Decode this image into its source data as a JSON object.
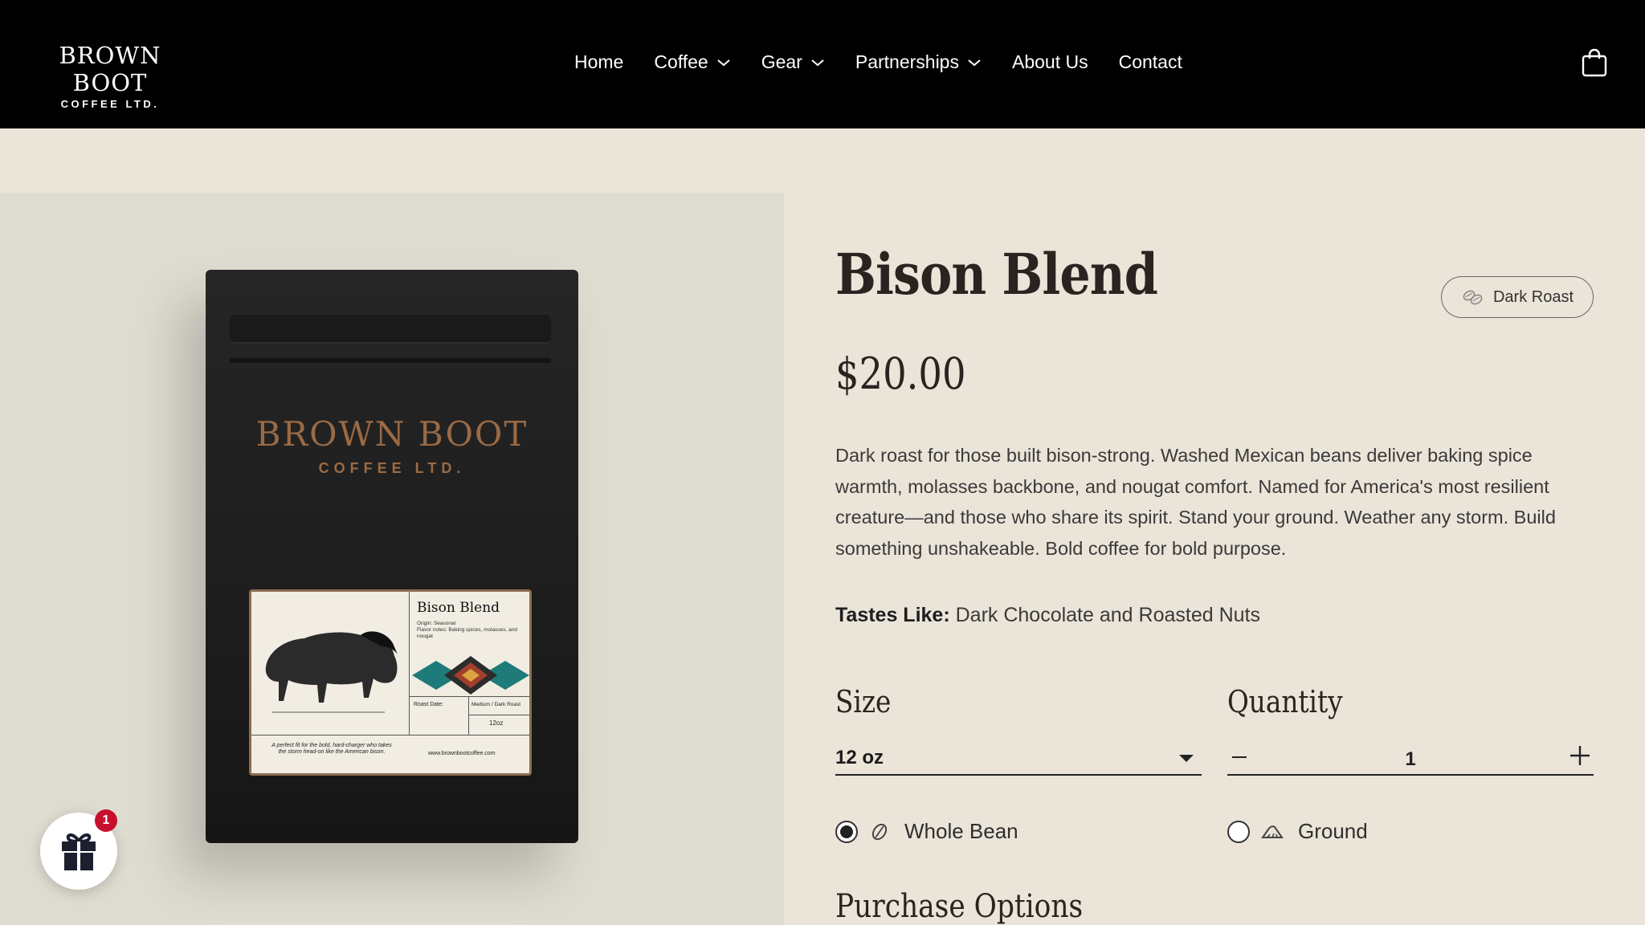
{
  "header": {
    "logo": {
      "main": "BROWN BOOT",
      "sub": "COFFEE LTD."
    },
    "nav": [
      {
        "label": "Home",
        "has_dropdown": false
      },
      {
        "label": "Coffee",
        "has_dropdown": true
      },
      {
        "label": "Gear",
        "has_dropdown": true
      },
      {
        "label": "Partnerships",
        "has_dropdown": true
      },
      {
        "label": "About Us",
        "has_dropdown": false
      },
      {
        "label": "Contact",
        "has_dropdown": false
      }
    ],
    "cart_icon": "shopping-bag-icon"
  },
  "product_image": {
    "bag_brand_main": "BROWN BOOT",
    "bag_brand_sub": "COFFEE LTD.",
    "label": {
      "title": "Bison Blend",
      "origin": "Origin: Seasonal",
      "flavor_notes": "Flavor notes: Baking spices, molasses, and nougat",
      "roast_date": "Roast Date:",
      "roast_level": "Medium / Dark Roast",
      "size": "12oz",
      "tagline": "A perfect fit for the bold, hard-charger who takes the storm head-on like the American bison.",
      "url": "www.brownbootcoffee.com"
    }
  },
  "gift": {
    "icon": "gift-icon",
    "badge_count": "1"
  },
  "product": {
    "title": "Bison Blend",
    "roast_badge": "Dark Roast",
    "price": "$20.00",
    "description": "Dark roast for those built bison-strong. Washed Mexican beans deliver baking spice warmth, molasses backbone, and nougat comfort. Named for America's most resilient creature—and those who share its spirit. Stand your ground. Weather any storm. Build something unshakeable. Bold coffee for bold purpose.",
    "tastes_like_label": "Tastes Like:",
    "tastes_like_value": "Dark Chocolate and Roasted Nuts",
    "size_label": "Size",
    "size_value": "12 oz",
    "quantity_label": "Quantity",
    "quantity_value": "1",
    "grind_options": [
      {
        "label": "Whole Bean",
        "selected": true,
        "icon": "coffee-bean-icon"
      },
      {
        "label": "Ground",
        "selected": false,
        "icon": "ground-coffee-icon"
      }
    ],
    "purchase_options_label": "Purchase Options"
  },
  "colors": {
    "header_bg": "#000000",
    "page_bg": "#ebe4d9",
    "image_bg": "#dedcd0",
    "badge_red": "#c8102e",
    "bag_brand": "#9a6a45"
  }
}
